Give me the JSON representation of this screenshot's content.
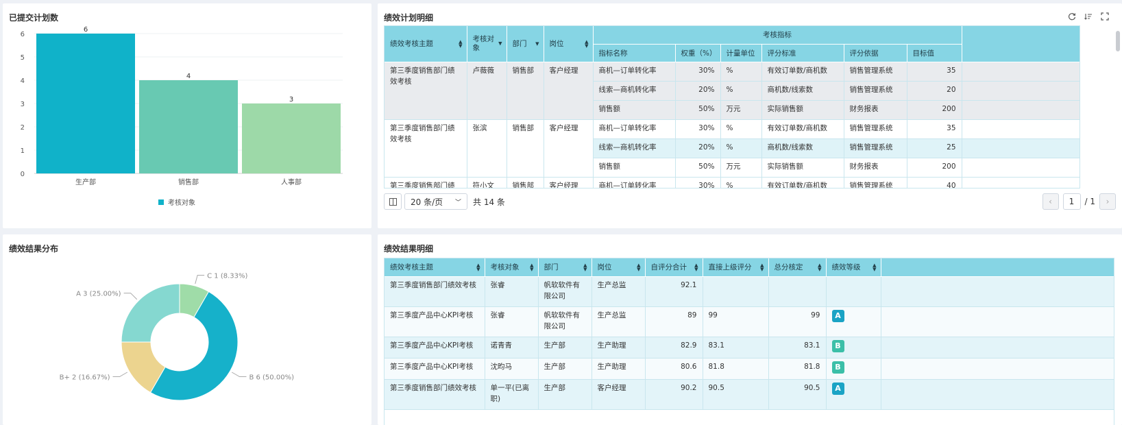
{
  "bar_panel": {
    "title": "已提交计划数"
  },
  "pie_panel": {
    "title": "绩效结果分布"
  },
  "chart_data": [
    {
      "type": "bar",
      "title": "已提交计划数",
      "categories": [
        "生产部",
        "销售部",
        "人事部"
      ],
      "series": [
        {
          "name": "考核对象",
          "values": [
            6,
            4,
            3
          ]
        }
      ],
      "ylim": [
        0,
        6
      ],
      "yticks": [
        0,
        1,
        2,
        3,
        4,
        5,
        6
      ],
      "colors": [
        "#10b2c9",
        "#68c9b2",
        "#9dd9a8"
      ],
      "grid": true,
      "legend": "bottom"
    },
    {
      "type": "pie",
      "title": "绩效结果分布",
      "donut": true,
      "slices": [
        {
          "name": "C",
          "value": 1,
          "label": "C 1 (8.33%)",
          "color": "#9fdca8"
        },
        {
          "name": "B",
          "value": 6,
          "label": "B 6 (50.00%)",
          "color": "#16b1ca"
        },
        {
          "name": "B+",
          "value": 2,
          "label": "B+ 2 (16.67%)",
          "color": "#ecd48f"
        },
        {
          "name": "A",
          "value": 3,
          "label": "A 3 (25.00%)",
          "color": "#85d8d0"
        }
      ]
    }
  ],
  "plan": {
    "title": "绩效计划明细",
    "headers": {
      "theme": "绩效考核主题",
      "target": "考核对象",
      "dept": "部门",
      "post": "岗位",
      "group": "考核指标",
      "kpi": "指标名称",
      "weight": "权重（%）",
      "unit": "计量单位",
      "standard": "评分标准",
      "basis": "评分依据",
      "goal": "目标值"
    },
    "groups": [
      {
        "theme": "第三季度销售部门绩效考核",
        "target": "卢薇薇",
        "dept": "销售部",
        "post": "客户经理",
        "rows": [
          {
            "kpi": "商机—订单转化率",
            "weight": "30%",
            "unit": "%",
            "standard": "有效订单数/商机数",
            "basis": "销售管理系统",
            "goal": "35"
          },
          {
            "kpi": "线索—商机转化率",
            "weight": "20%",
            "unit": "%",
            "standard": "商机数/线索数",
            "basis": "销售管理系统",
            "goal": "20"
          },
          {
            "kpi": "销售额",
            "weight": "50%",
            "unit": "万元",
            "standard": "实际销售额",
            "basis": "财务报表",
            "goal": "200"
          }
        ]
      },
      {
        "theme": "第三季度销售部门绩效考核",
        "target": "张滨",
        "dept": "销售部",
        "post": "客户经理",
        "rows": [
          {
            "kpi": "商机—订单转化率",
            "weight": "30%",
            "unit": "%",
            "standard": "有效订单数/商机数",
            "basis": "销售管理系统",
            "goal": "35"
          },
          {
            "kpi": "线索—商机转化率",
            "weight": "20%",
            "unit": "%",
            "standard": "商机数/线索数",
            "basis": "销售管理系统",
            "goal": "25"
          },
          {
            "kpi": "销售额",
            "weight": "50%",
            "unit": "万元",
            "standard": "实际销售额",
            "basis": "财务报表",
            "goal": "200"
          }
        ]
      },
      {
        "theme": "第三季度销售部门绩",
        "target": "符小文",
        "dept": "销售部",
        "post": "客户经理",
        "rows": [
          {
            "kpi": "商机—订单转化率",
            "weight": "30%",
            "unit": "%",
            "standard": "有效订单数/商机数",
            "basis": "销售管理系统",
            "goal": "40"
          }
        ]
      }
    ],
    "pager": {
      "page_size": "20 条/页",
      "total": "共 14 条",
      "page": "1",
      "pages": "/ 1"
    }
  },
  "result": {
    "title": "绩效结果明细",
    "headers": [
      "绩效考核主题",
      "考核对象",
      "部门",
      "岗位",
      "自评分合计",
      "直接上级评分",
      "总分核定",
      "绩效等级"
    ],
    "rows": [
      {
        "theme": "第三季度销售部门绩效考核",
        "target": "张睿",
        "dept": "帆软软件有限公司",
        "post": "生产总监",
        "self": "92.1",
        "boss": "",
        "total": "",
        "grade": ""
      },
      {
        "theme": "第三季度产品中心KPI考核",
        "target": "张睿",
        "dept": "帆软软件有限公司",
        "post": "生产总监",
        "self": "89",
        "boss": "99",
        "total": "99",
        "grade": "A"
      },
      {
        "theme": "第三季度产品中心KPI考核",
        "target": "诺青青",
        "dept": "生产部",
        "post": "生产助理",
        "self": "82.9",
        "boss": "83.1",
        "total": "83.1",
        "grade": "B"
      },
      {
        "theme": "第三季度产品中心KPI考核",
        "target": "沈昀马",
        "dept": "生产部",
        "post": "生产助理",
        "self": "80.6",
        "boss": "81.8",
        "total": "81.8",
        "grade": "B"
      },
      {
        "theme": "第三季度销售部门绩效考核",
        "target": "单一平(已离职)",
        "dept": "生产部",
        "post": "客户经理",
        "self": "90.2",
        "boss": "90.5",
        "total": "90.5",
        "grade": "A"
      }
    ]
  }
}
